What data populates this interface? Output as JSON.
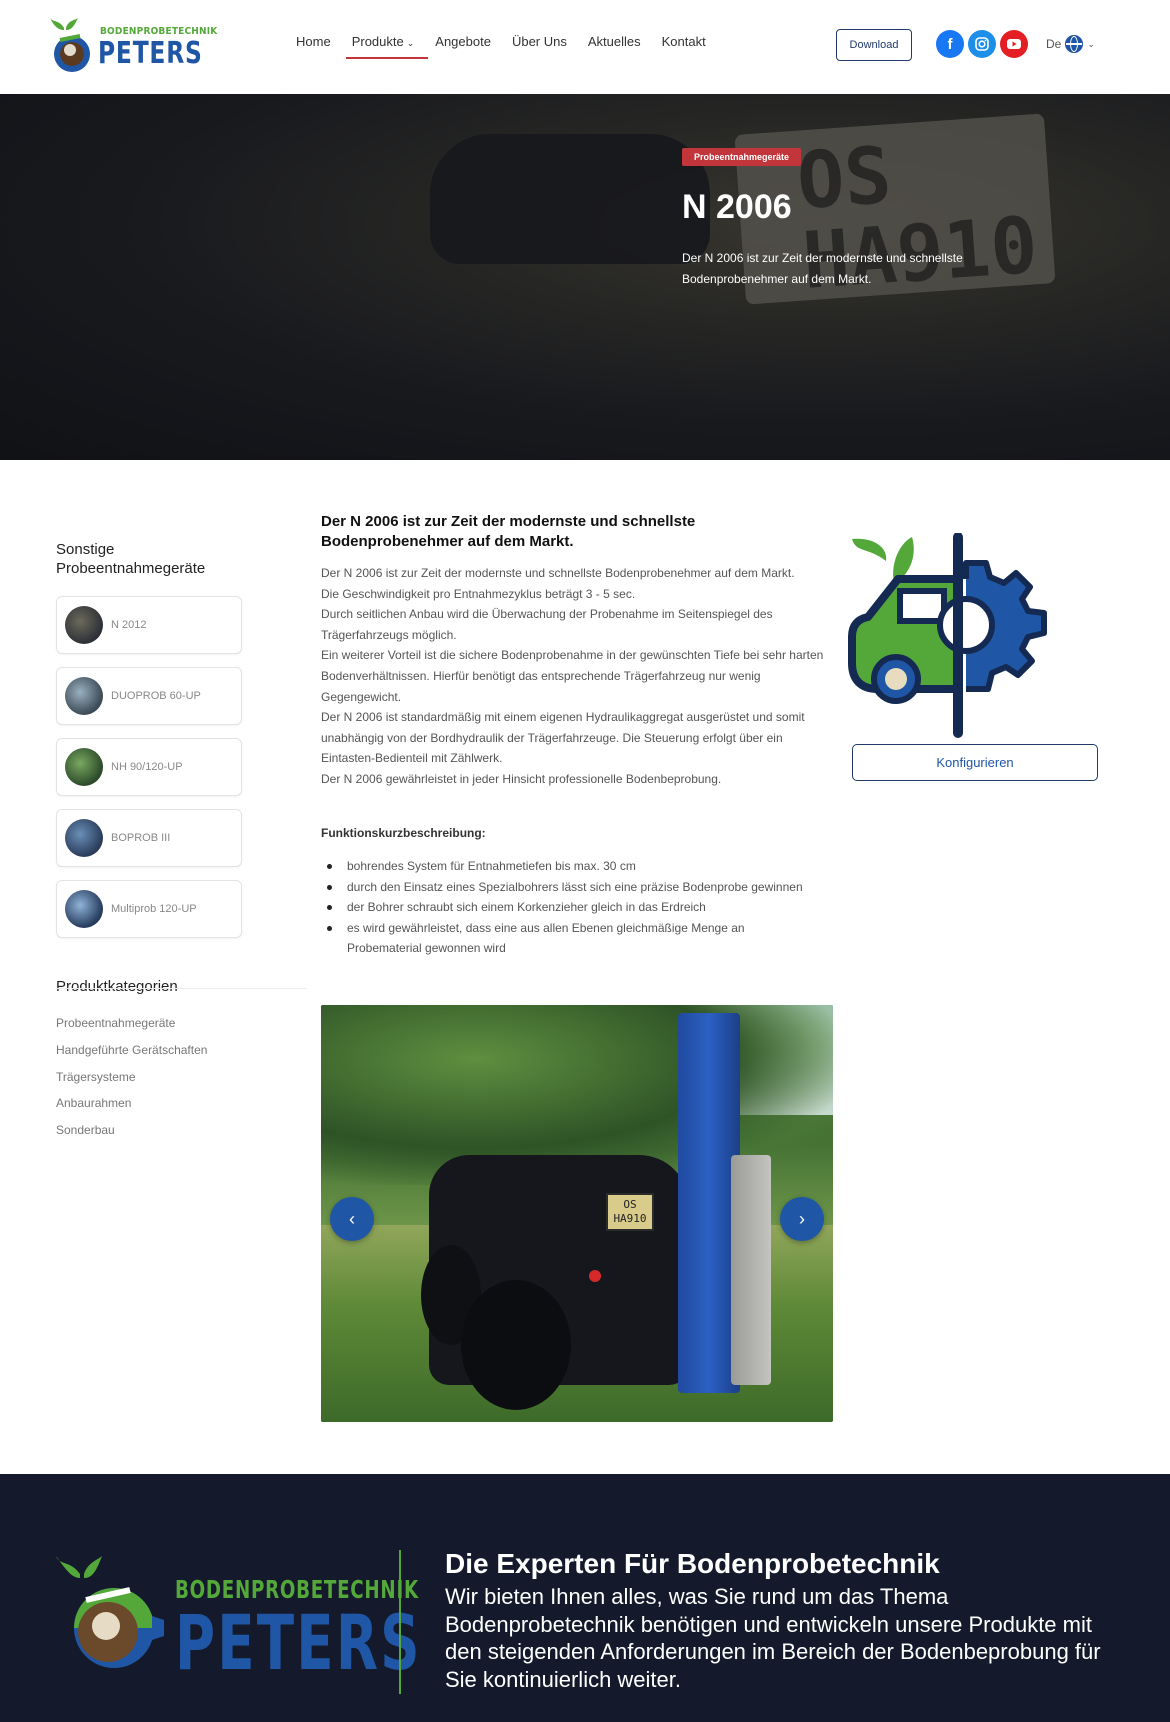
{
  "header": {
    "logo_top": "BODENPROBETECHNIK",
    "logo_main": "PETERS",
    "nav": [
      {
        "label": "Home"
      },
      {
        "label": "Produkte",
        "active": true
      },
      {
        "label": "Angebote"
      },
      {
        "label": "Über Uns"
      },
      {
        "label": "Aktuelles"
      },
      {
        "label": "Kontakt"
      }
    ],
    "download": "Download",
    "lang": "De",
    "social": [
      "facebook-icon",
      "instagram-icon",
      "youtube-icon"
    ]
  },
  "hero": {
    "badge": "Probeentnahmegeräte",
    "title": "N 2006",
    "subtitle": "Der N 2006 ist zur Zeit der modernste und schnellste Bodenprobenehmer auf dem Markt."
  },
  "sidebar": {
    "title": "Sonstige Probeentnahmegeräte",
    "items": [
      {
        "label": "N 2012"
      },
      {
        "label": "DUOPROB 60-UP"
      },
      {
        "label": "NH 90/120-UP"
      },
      {
        "label": "BOPROB III"
      },
      {
        "label": "Multiprob 120-UP"
      }
    ],
    "categories_title": "Produktkategorien",
    "categories": [
      "Probeentnahmegeräte",
      "Handgeführte Gerätschaften",
      "Trägersysteme",
      "Anbaurahmen",
      "Sonderbau"
    ]
  },
  "main": {
    "title": "Der N 2006 ist zur Zeit der modernste und schnellste Bodenprobenehmer auf dem Markt.",
    "paragraphs": [
      "Der N 2006 ist zur Zeit der modernste und schnellste Bodenprobenehmer auf dem Markt.",
      "Die Geschwindigkeit pro Entnahmezyklus beträgt 3 - 5 sec.",
      "Durch seitlichen Anbau wird die Überwachung der Probenahme im Seitenspiegel des Trägerfahrzeugs möglich.",
      "Ein weiterer Vorteil ist die sichere Bodenprobenahme in der gewünschten Tiefe bei sehr harten Bodenverhältnissen. Hierfür benötigt das entsprechende Trägerfahrzeug nur wenig Gegengewicht.",
      "Der N 2006 ist standardmäßig mit einem eigenen Hydraulikaggregat ausgerüstet und somit unabhängig von der Bordhydraulik der Trägerfahrzeuge. Die Steuerung erfolgt über ein Eintasten-Bedienteil mit Zählwerk.",
      "Der N 2006 gewährleistet in jeder Hinsicht professionelle Bodenbeprobung."
    ],
    "func_title": "Funktionskurzbeschreibung:",
    "bullets": [
      "bohrendes System für Entnahmetiefen bis max. 30 cm",
      "durch den Einsatz eines Spezialbohrers lässt sich eine präzise Bodenprobe gewinnen",
      "der Bohrer schraubt sich einem Korkenzieher gleich in das Erdreich",
      "es wird gewährleistet, dass eine aus allen Ebenen gleichmäßige Menge an Probematerial gewonnen wird"
    ],
    "configure": "Konfigurieren",
    "gallery_plate": [
      "OS",
      "HA910"
    ],
    "prev_glyph": "‹",
    "next_glyph": "›"
  },
  "footer": {
    "brand_top": "BODENPROBETECHNIK",
    "brand_main": "PETERS",
    "title": "Die Experten Für Bodenprobetechnik",
    "text": "Wir bieten Ihnen alles, was Sie rund um das Thema Bodenprobetechnik benötigen und entwickeln unsere Produkte mit den steigenden Anforderungen im Bereich der Bodenbeprobung für Sie kontinuierlich weiter."
  },
  "colors": {
    "brand_blue": "#1f56a5",
    "brand_green": "#54a83a",
    "accent_red": "#c2353b",
    "footer_bg": "#141a2b"
  }
}
